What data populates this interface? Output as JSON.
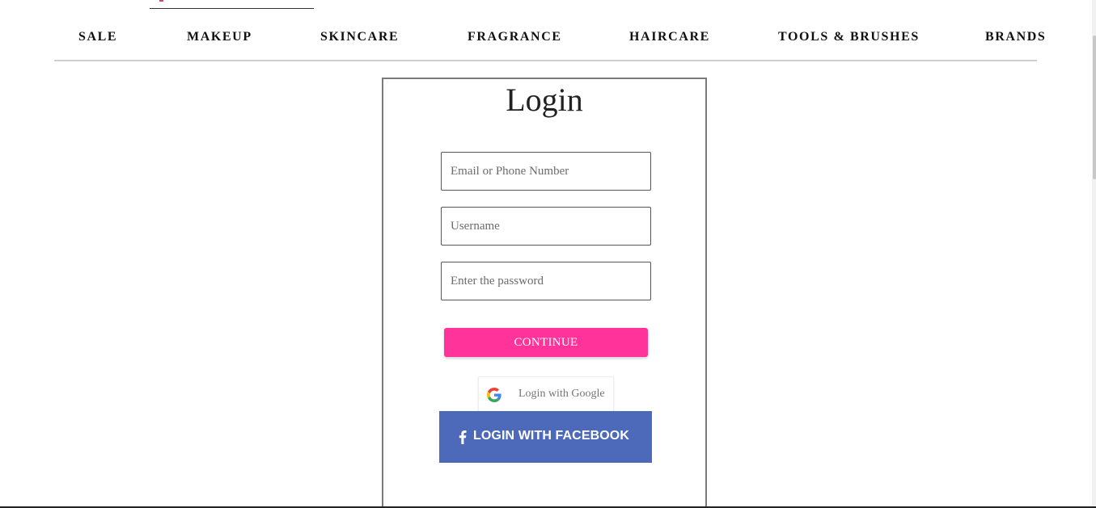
{
  "nav": {
    "items": [
      {
        "label": "SALE"
      },
      {
        "label": "MAKEUP"
      },
      {
        "label": "SKINCARE"
      },
      {
        "label": "FRAGRANCE"
      },
      {
        "label": "HAIRCARE"
      },
      {
        "label": "TOOLS & BRUSHES"
      },
      {
        "label": "BRANDS"
      }
    ]
  },
  "login": {
    "title": "Login",
    "email_placeholder": "Email or Phone Number",
    "username_placeholder": "Username",
    "password_placeholder": "Enter the password",
    "continue_label": "CONTINUE",
    "google_label": "Login with Google",
    "facebook_label": "LOGIN WITH FACEBOOK"
  },
  "icons": {
    "google": "google-icon",
    "facebook": "facebook-icon"
  },
  "colors": {
    "continue_button": "#ff3399",
    "facebook_button": "#4c69ba",
    "google_blue": "#4285F4",
    "google_red": "#EA4335",
    "google_yellow": "#FBBC05",
    "google_green": "#34A853"
  }
}
